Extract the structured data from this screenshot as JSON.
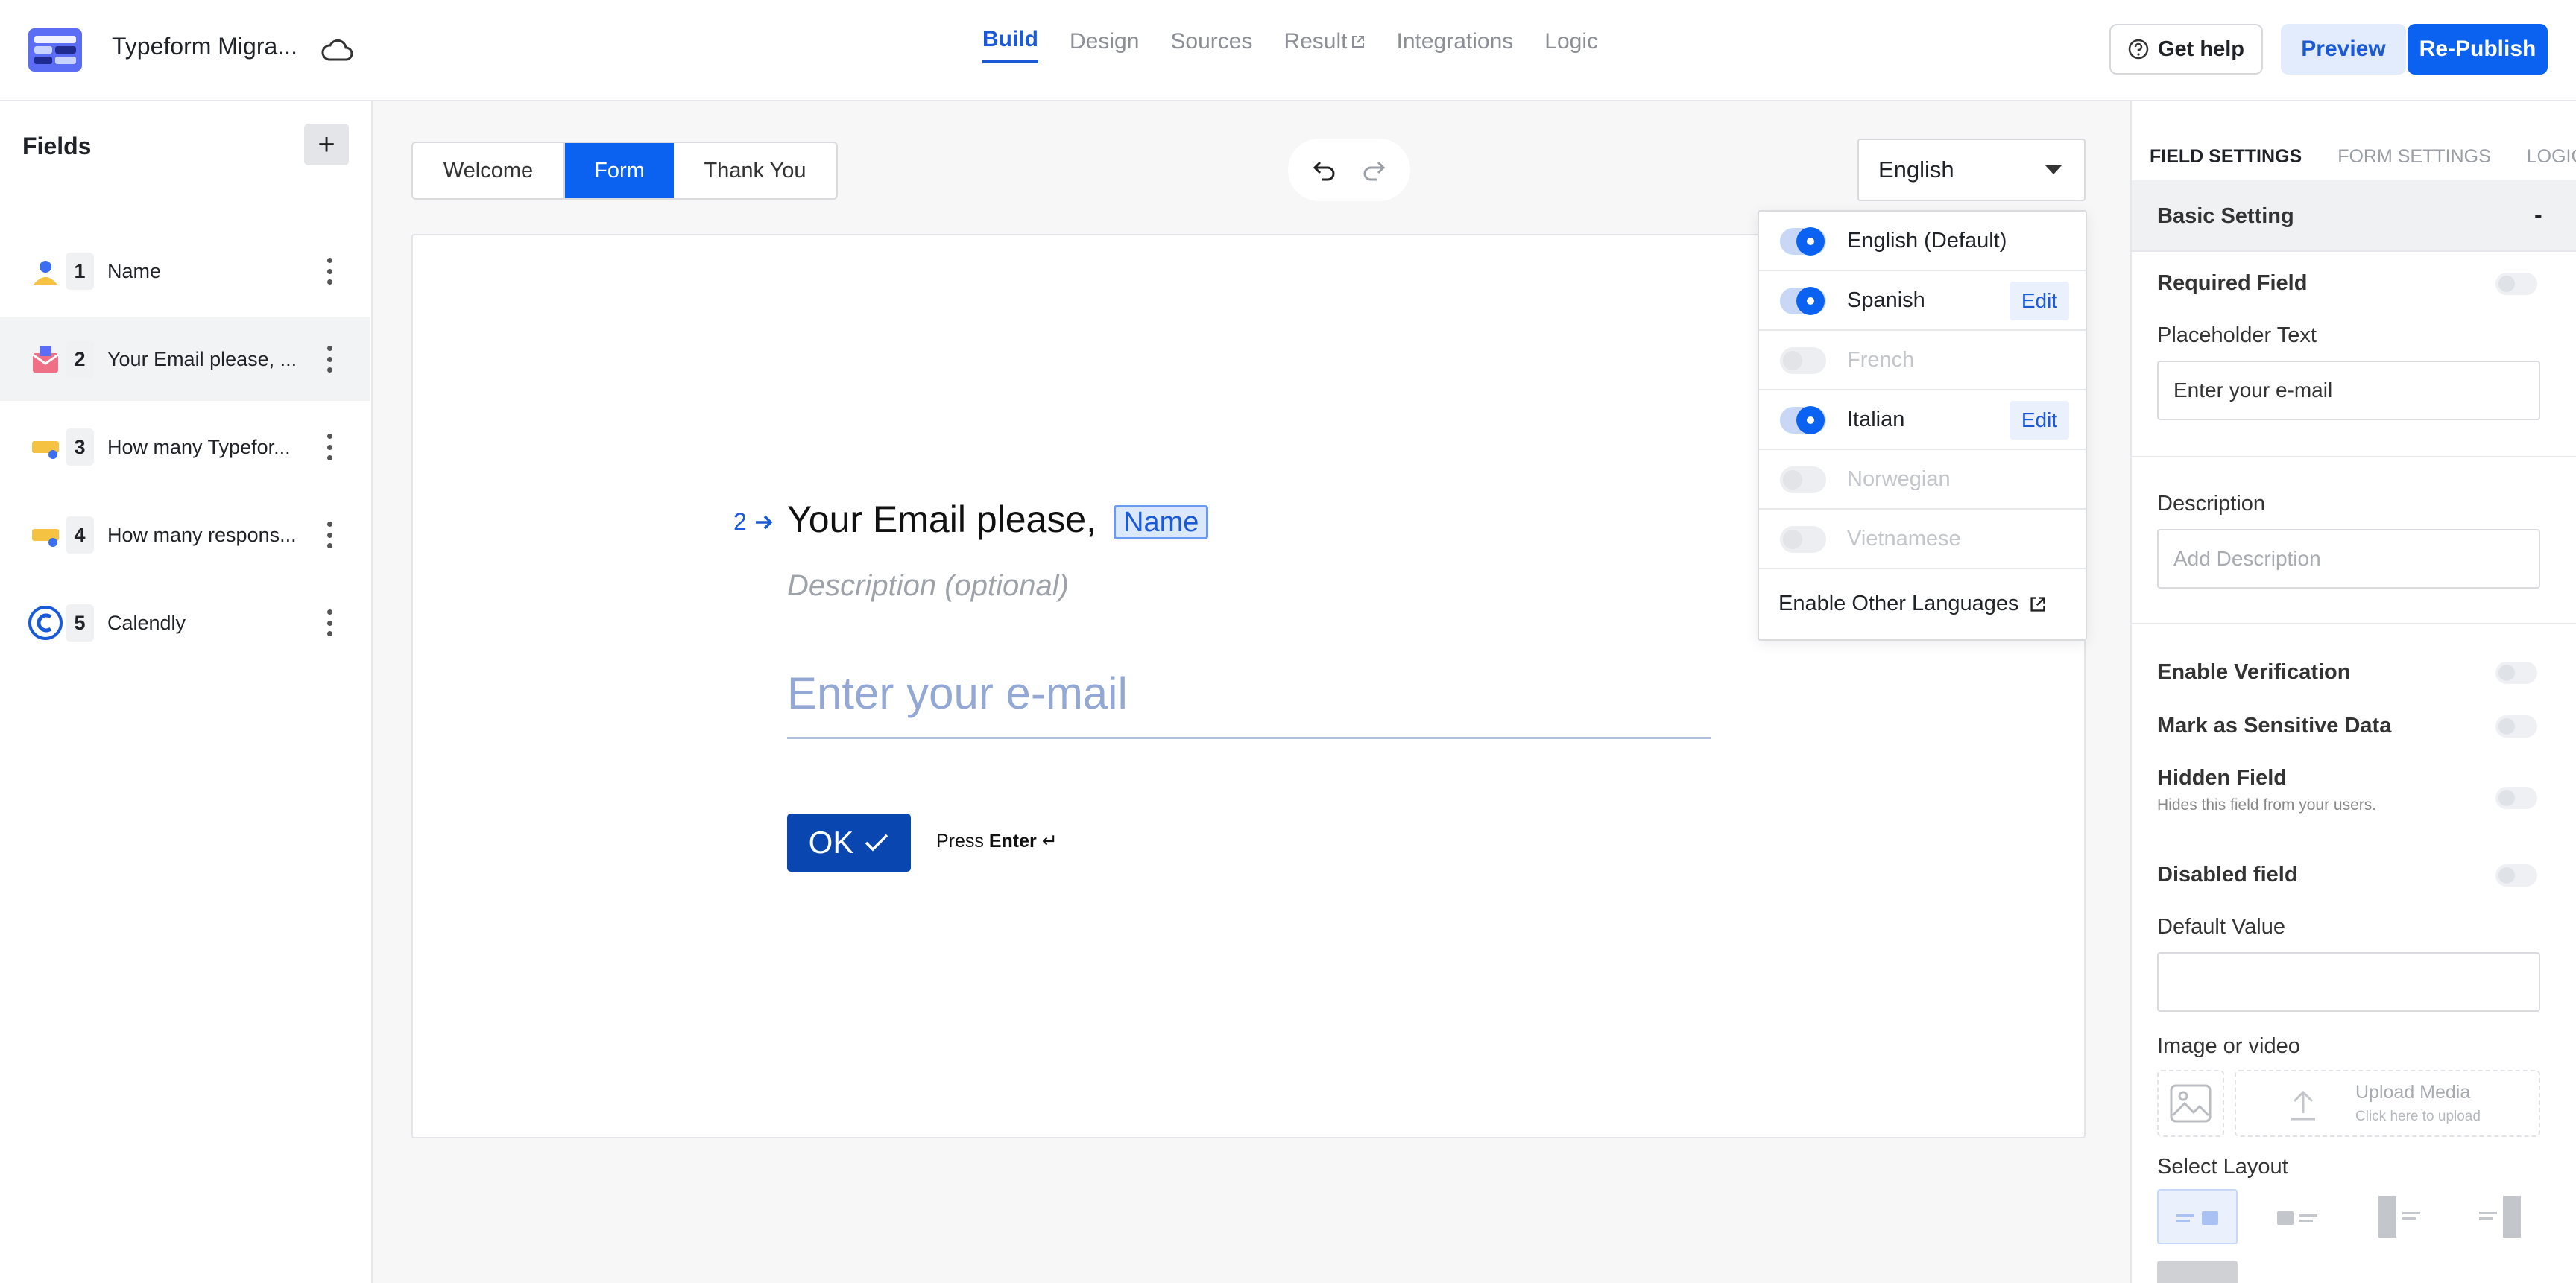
{
  "header": {
    "form_title": "Typeform Migra...",
    "nav_tabs": [
      {
        "label": "Build",
        "active": true
      },
      {
        "label": "Design"
      },
      {
        "label": "Sources"
      },
      {
        "label": "Result"
      },
      {
        "label": "Integrations"
      },
      {
        "label": "Logic"
      }
    ],
    "help_label": "Get help",
    "preview_label": "Preview",
    "publish_label": "Re-Publish"
  },
  "sidebar": {
    "title": "Fields",
    "add_label": "+",
    "fields": [
      {
        "num": "1",
        "label": "Name",
        "icon": "person-icon"
      },
      {
        "num": "2",
        "label": "Your Email please,   ...",
        "icon": "email-icon",
        "active": true
      },
      {
        "num": "3",
        "label": "How many Typefor...",
        "icon": "number-icon"
      },
      {
        "num": "4",
        "label": "How many respons...",
        "icon": "number-icon"
      },
      {
        "num": "5",
        "label": "Calendly",
        "icon": "calendly-icon"
      }
    ]
  },
  "canvas": {
    "tabs": [
      "Welcome",
      "Form",
      "Thank You"
    ],
    "active_tab": "Form",
    "language_selected": "English",
    "question": {
      "number": "2",
      "title": "Your Email please,",
      "recall_chip": "Name",
      "description": "Description (optional)",
      "input_placeholder": "Enter your e-mail",
      "ok_label": "OK",
      "press_label": "Press",
      "enter_label": "Enter"
    }
  },
  "language_menu": {
    "languages": [
      {
        "name": "English (Default)",
        "enabled": true
      },
      {
        "name": "Spanish",
        "enabled": true,
        "edit": "Edit"
      },
      {
        "name": "French",
        "enabled": false
      },
      {
        "name": "Italian",
        "enabled": true,
        "edit": "Edit"
      },
      {
        "name": "Norwegian",
        "enabled": false
      },
      {
        "name": "Vietnamese",
        "enabled": false
      }
    ],
    "other_label": "Enable Other Languages"
  },
  "right_panel": {
    "tabs": [
      "FIELD SETTINGS",
      "FORM SETTINGS",
      "LOGIC"
    ],
    "active_tab": "FIELD SETTINGS",
    "section_title": "Basic Setting",
    "section_toggle": "-",
    "required_label": "Required Field",
    "placeholder_label": "Placeholder Text",
    "placeholder_value": "Enter your e-mail",
    "description_label": "Description",
    "description_placeholder": "Add Description",
    "verification_label": "Enable Verification",
    "sensitive_label": "Mark as Sensitive Data",
    "hidden_label": "Hidden Field",
    "hidden_sub": "Hides this field from your users.",
    "disabled_label": "Disabled field",
    "default_label": "Default Value",
    "default_value": "",
    "media_label": "Image or video",
    "upload_title": "Upload Media",
    "upload_sub": "Click here to upload",
    "layout_label": "Select Layout"
  },
  "colors": {
    "primary": "#0b62f0",
    "ok_button": "#0a46b0",
    "accent_text": "#1a5ad7"
  }
}
